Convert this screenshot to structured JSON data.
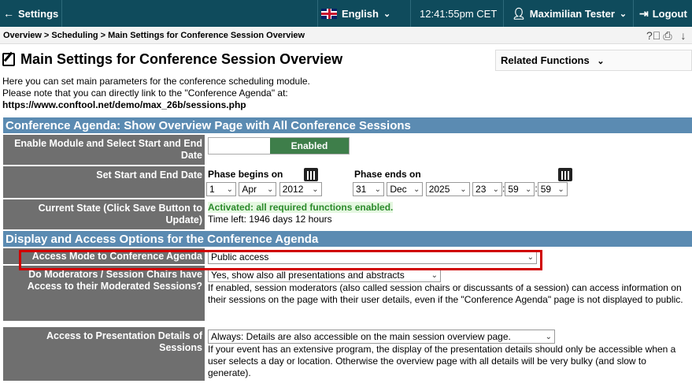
{
  "topbar": {
    "settings": "Settings",
    "language": "English",
    "time": "12:41:55pm CET",
    "user": "Maximilian Tester",
    "logout": "Logout"
  },
  "breadcrumb": {
    "items": [
      "Overview",
      "Scheduling",
      "Main Settings for Conference Session Overview"
    ]
  },
  "page": {
    "title": "Main Settings for Conference Session Overview",
    "related": "Related Functions",
    "intro1": "Here you can set main parameters for the conference scheduling module.",
    "intro2": "Please note that you can directly link to the \"Conference Agenda\" at:",
    "link": "https://www.conftool.net/demo/max_26b/sessions.php"
  },
  "sections": {
    "agenda": "Conference Agenda: Show Overview Page with All Conference Sessions",
    "display": "Display and Access Options for the Conference Agenda"
  },
  "rows": {
    "enable_label": "Enable Module and Select Start and End Date",
    "enabled": "Enabled",
    "dates_label": "Set Start and End Date",
    "phase_begins": "Phase begins on",
    "phase_ends": "Phase ends on",
    "start": {
      "day": "1",
      "month": "Apr",
      "year": "2012"
    },
    "end": {
      "day": "31",
      "month": "Dec",
      "year": "2025",
      "hour": "23",
      "minute": "59",
      "second": "59"
    },
    "state_label": "Current State (Click Save Button to Update)",
    "state_value": "Activated: all required functions enabled.",
    "time_left": "Time left: 1946 days 12 hours",
    "access_label": "Access Mode to Conference Agenda",
    "access_value": "Public access",
    "moderators_label": "Do Moderators / Session Chairs have Access to their Moderated Sessions?",
    "moderators_value": "Yes, show also all presentations and abstracts",
    "moderators_help": "If enabled, session moderators (also called session chairs or discussants of a session) can access information on their sessions on the page with their user details, even if the \"Conference Agenda\" page is not displayed to public.",
    "details_label": "Access to Presentation Details of Sessions",
    "details_value": "Always: Details are also accessible on the main session overview page.",
    "details_help": "If your event has an extensive program, the display of the presentation details should only be accessible when a user selects a day or location. Otherwise the overview page with all details will be very bulky (and slow to generate)."
  }
}
